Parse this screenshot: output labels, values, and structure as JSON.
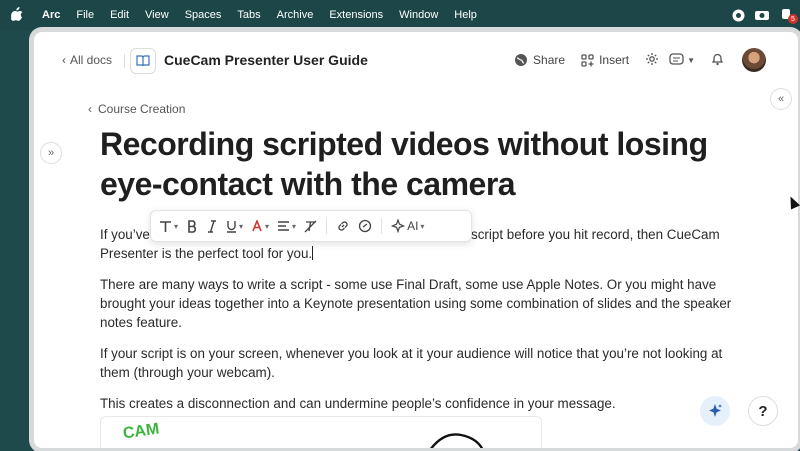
{
  "menubar": {
    "app": "Arc",
    "items": [
      "File",
      "Edit",
      "View",
      "Spaces",
      "Tabs",
      "Archive",
      "Extensions",
      "Window",
      "Help"
    ],
    "badge": "5"
  },
  "header": {
    "back_label": "All docs",
    "doc_title": "CueCam Presenter User Guide",
    "share_label": "Share",
    "insert_label": "Insert"
  },
  "breadcrumb": "Course Creation",
  "title": "Recording scripted videos without losing eye-contact with the camera",
  "toolbar": {
    "ai_label": "AI"
  },
  "body": {
    "p1_start": "If you’ve",
    "p1_end": "e script before you hit record, then CueCam",
    "p1_line2": "Presenter is the perfect tool for you.",
    "p2": "There are many ways to write a script - some use Final Draft, some use Apple Notes. Or you might have brought your ideas together into a Keynote presentation using some combination of slides and the speaker notes feature.",
    "p3": "If your script is on your screen, whenever you look at it your audience will notice that you’re not looking at them (through your webcam).",
    "p4": "This creates a disconnection and can undermine people’s confidence in your message."
  },
  "media_scribble": "CAM",
  "help_label": "?",
  "colors": {
    "menubar_bg": "#1d4648",
    "accent": "#3b6fb6",
    "text_red": "#d0342c"
  }
}
